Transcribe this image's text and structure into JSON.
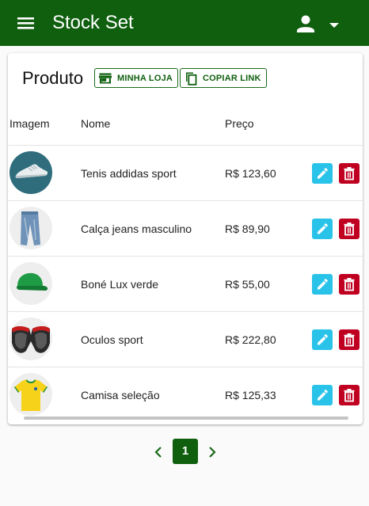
{
  "app": {
    "title": "Stock Set",
    "theme_color": "#0f5f0f"
  },
  "card": {
    "title": "Produto",
    "buttons": {
      "store_label": "MINHA LOJA",
      "copy_label": "COPIAR LINK"
    }
  },
  "table": {
    "columns": [
      "Imagem",
      "Nome",
      "Preço"
    ],
    "rows": [
      {
        "name": "Tenis addidas sport",
        "price": "R$ 123,60",
        "image": "sneaker"
      },
      {
        "name": "Calça jeans masculino",
        "price": "R$ 89,90",
        "image": "jeans"
      },
      {
        "name": "Boné Lux verde",
        "price": "R$ 55,00",
        "image": "cap"
      },
      {
        "name": "Oculos sport",
        "price": "R$ 222,80",
        "image": "sunglasses"
      },
      {
        "name": "Camisa seleção",
        "price": "R$ 125,33",
        "image": "jersey"
      }
    ]
  },
  "pagination": {
    "current": "1"
  },
  "colors": {
    "edit": "#29c3ea",
    "delete": "#c00020"
  }
}
